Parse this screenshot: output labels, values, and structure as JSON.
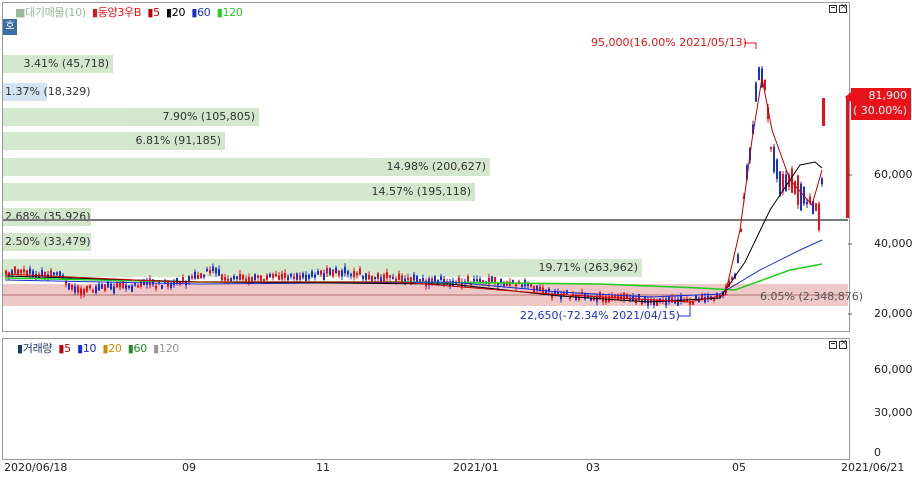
{
  "top_legend": {
    "vol_profile": "■대기매물(10)",
    "stock": "▮동양3우B",
    "ma5": "▮5",
    "ma20": "▮20",
    "ma60": "▮60",
    "ma120": "▮120"
  },
  "side_tab": "호",
  "bottom_legend": {
    "title": "▮거래량",
    "v5": "▮5",
    "v10": "▮10",
    "v20": "▮20",
    "v60": "▮60",
    "v120": "▮120"
  },
  "volume_profile": [
    "3.41% (45,718)",
    "1.37% (18,329)",
    "7.90% (105,805)",
    "6.81% (91,185)",
    "14.98% (200,627)",
    "14.57% (195,118)",
    "2.68% (35,926)",
    "2.50% (33,479)",
    "19.71% (263,962)",
    "6.05% (2,348,876)"
  ],
  "annotations": {
    "high": "95,000(16.00% 2021/05/13)",
    "low": "22,650(-72.34% 2021/04/15)"
  },
  "current_price": {
    "price": "81,900",
    "change": "( 30.00%)"
  },
  "price_axis": [
    "60,000",
    "40,000",
    "20,000"
  ],
  "volume_axis": [
    "60,000",
    "30,000",
    "0"
  ],
  "date_axis": [
    "2020/06/18",
    "09",
    "11",
    "2021/01",
    "03",
    "05",
    "2021/06/21"
  ],
  "colors": {
    "up": "#e8121a",
    "down": "#1a2fd0",
    "ma5": "#c00000",
    "ma20": "#000000",
    "ma60": "#1a2fd0",
    "ma120": "#22cc22",
    "profile_green": "#cfe6c8",
    "profile_blue": "#cfe1f0",
    "profile_red": "#e8b4b4"
  }
}
